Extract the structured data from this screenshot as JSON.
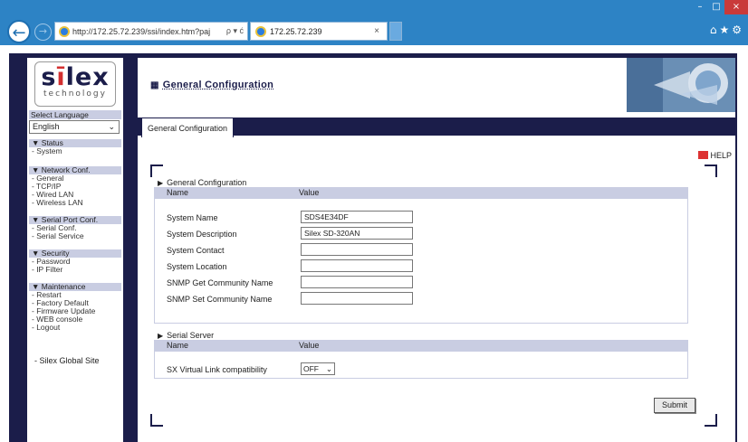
{
  "browser": {
    "address": "http://172.25.72.239/ssi/index.htm?paϳ",
    "address_host": "172.25.72.239",
    "tab_title": "172.25.72.239",
    "tab_close": "×",
    "address_tools": "ρ ▾ ć"
  },
  "window": {
    "minimize": "–",
    "maximize": "□",
    "close": "×"
  },
  "sidebar": {
    "logo_text": "silex",
    "logo_sub": "technology",
    "language_label": "Select Language",
    "language_value": "English",
    "sections": [
      {
        "title": "▼ Status",
        "items": [
          "- System"
        ]
      },
      {
        "title": "▼ Network Conf.",
        "items": [
          "- General",
          "- TCP/IP",
          "- Wired LAN",
          "- Wireless LAN"
        ]
      },
      {
        "title": "▼ Serial Port Conf.",
        "items": [
          "- Serial Conf.",
          "- Serial Service"
        ]
      },
      {
        "title": "▼ Security",
        "items": [
          "- Password",
          "- IP Filter"
        ]
      },
      {
        "title": "▼ Maintenance",
        "items": [
          "- Restart",
          "- Factory Default",
          "- Firmware Update",
          "- WEB console",
          "- Logout"
        ]
      }
    ],
    "global_link": "- Silex Global Site"
  },
  "main": {
    "page_title": "General Configuration",
    "active_tab": "General Configuration",
    "help": "HELP",
    "general": {
      "title": "General Configuration",
      "col_name": "Name",
      "col_value": "Value",
      "fields": [
        {
          "label": "System Name",
          "value": "SDS4E34DF"
        },
        {
          "label": "System Description",
          "value": "Silex SD-320AN"
        },
        {
          "label": "System Contact",
          "value": ""
        },
        {
          "label": "System Location",
          "value": ""
        },
        {
          "label": "SNMP Get Community Name",
          "value": ""
        },
        {
          "label": "SNMP Set Community Name",
          "value": ""
        }
      ]
    },
    "serial": {
      "title": "Serial Server",
      "col_name": "Name",
      "col_value": "Value",
      "field_label": "SX Virtual Link compatibility",
      "field_value": "OFF"
    },
    "submit": "Submit"
  }
}
